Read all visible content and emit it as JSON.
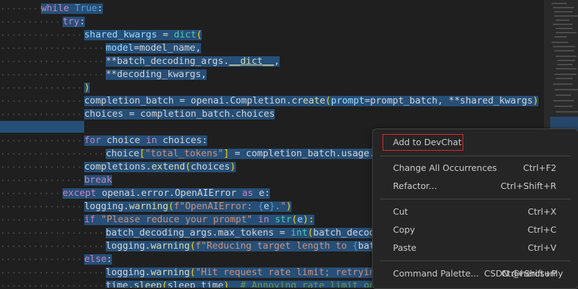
{
  "editor": {
    "line_while": {
      "kw": "while",
      "val": "True",
      "colon": ":"
    },
    "line_try": {
      "kw": "try",
      "colon": ":"
    },
    "line_shared": {
      "var": "shared_kwargs",
      "op": " = ",
      "fn": "dict",
      "open": "("
    },
    "line_model": {
      "prm": "model",
      "rest": "=model_name,"
    },
    "line_batchargs": {
      "pre": "**batch_decoding_args.",
      "dunder": "__dict__",
      "post": ","
    },
    "line_decoding": {
      "text": "**decoding_kwargs,"
    },
    "line_close": {
      "text": ")"
    },
    "line_completion": {
      "pre": "completion_batch = openai.Completion.",
      "fn": "create",
      "open": "(",
      "prm": "prompt",
      "mid": "=prompt_batch, **shared_kwargs",
      "close": ")"
    },
    "line_choices": {
      "text": "choices = completion_batch.choices"
    },
    "line_for": {
      "kw": "for",
      "a": " choice ",
      "kw2": "in",
      "b": " choices:"
    },
    "line_choice_assign": {
      "pre": "choice",
      "ob": "[",
      "str": "\"total_tokens\"",
      "cb": "]",
      "post": " = completion_batch.usage.to"
    },
    "line_extend": {
      "pre": "completions.",
      "fn": "extend",
      "open": "(",
      "mid": "choices",
      "close": ")"
    },
    "line_break": {
      "kw": "break"
    },
    "line_except": {
      "kw": "except",
      "mid": " openai.error.OpenAIError ",
      "kw2": "as",
      "post": " e:"
    },
    "line_logwarn1": {
      "pre": "logging.",
      "fn": "warning",
      "open": "(",
      "str1": "f\"OpenAIError: ",
      "ib": "{",
      "v": "e",
      "cb": "}",
      "str2": ".\"",
      "close": ")"
    },
    "line_if": {
      "kw": "if",
      "str": " \"Please reduce your prompt\" ",
      "kw2": "in",
      "sp": " ",
      "fn": "str",
      "open": "(",
      "v": "e",
      "close": "):"
    },
    "line_maxtok": {
      "pre": "batch_decoding_args.max_tokens = ",
      "fn": "int",
      "open": "(",
      "post": "batch_decodin"
    },
    "line_logwarn2": {
      "pre": "logging.",
      "fn": "warning",
      "open": "(",
      "str": "f\"Reducing target length to ",
      "ib": "{",
      "post": "batch"
    },
    "line_else": {
      "kw": "else",
      "colon": ":"
    },
    "line_logwarn3": {
      "pre": "logging.",
      "fn": "warning",
      "open": "(",
      "str": "\"Hit request rate limit; retrying."
    },
    "line_sleep": {
      "pre": "time.",
      "fn": "sleep",
      "open": "(",
      "mid": "sleep_time",
      "close": ")",
      "cmt": "  # Annoying rate limit on requests."
    }
  },
  "context_menu": {
    "items": [
      {
        "label": "Add to DevChat",
        "shortcut": ""
      },
      {
        "label": "Change All Occurrences",
        "shortcut": "Ctrl+F2"
      },
      {
        "label": "Refactor...",
        "shortcut": "Ctrl+Shift+R"
      },
      {
        "label": "Cut",
        "shortcut": "Ctrl+X"
      },
      {
        "label": "Copy",
        "shortcut": "Ctrl+C"
      },
      {
        "label": "Paste",
        "shortcut": "Ctrl+V"
      },
      {
        "label": "Command Palette...",
        "shortcut": "Ctrl+Shift+P"
      }
    ]
  },
  "watermark": "CSDN @herosunly",
  "colors": {
    "background": "#1f1f1f",
    "selection": "#264f78",
    "keyword": "#c586c0",
    "function": "#dcdcaa",
    "string": "#ce9178",
    "highlight_border": "#e02a2a"
  }
}
